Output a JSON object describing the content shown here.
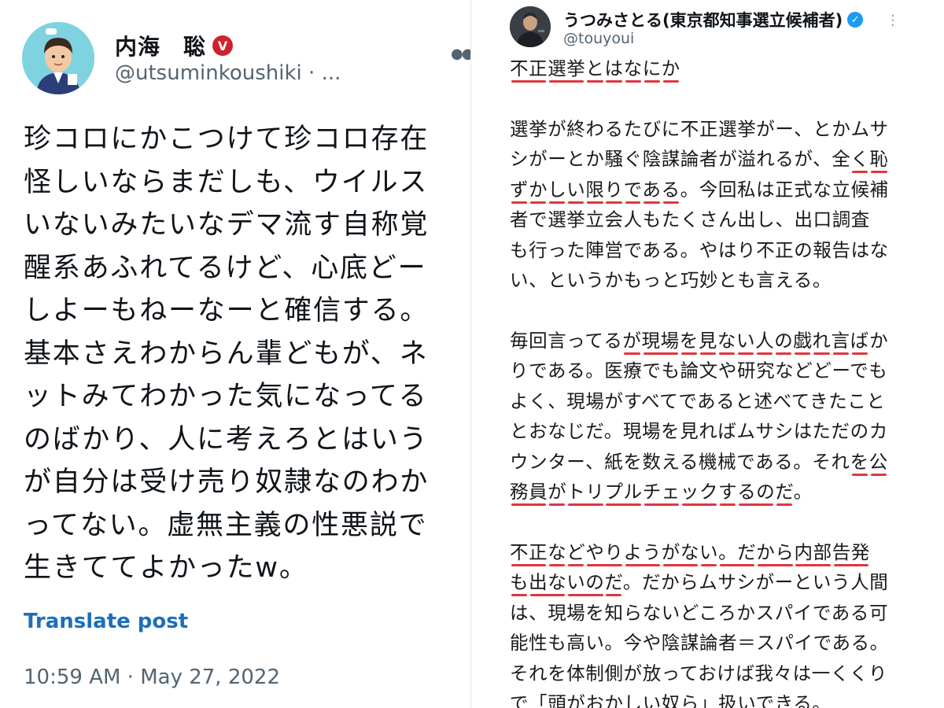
{
  "left_post": {
    "display_name": "内海　聡",
    "verified_badge": "V",
    "handle": "@utsuminkoushiki · ...",
    "body_lines": [
      "珍コロにかこつけて珍コロ存在",
      "怪しいならまだしも、ウイルス",
      "いないみたいなデマ流す自称覚",
      "醒系あふれてるけど、心底どー",
      "しよーもねーなーと確信する。",
      "基本さえわからん輩どもが、ネ",
      "ットみてわかった気になってる",
      "のばかり、人に考えろとはいう",
      "が自分は受け売り奴隷なのわか",
      "ってない。虚無主義の性悪説で",
      "生きててよかったw。"
    ],
    "translate_label": "Translate post",
    "timestamp": "10:59 AM · May 27, 2022",
    "more_icon": "ellipsis-icon",
    "badge_color": "#d0212c",
    "link_color": "#1d6fb8"
  },
  "right_post": {
    "display_name": "うつみさとる(東京都知事選立候補者)",
    "handle": "@touyoui",
    "verified_icon": "blue-check-icon",
    "more_icon": "vertical-ellipsis-icon",
    "title": "不正選挙とはなにか",
    "paragraphs": [
      [
        "選挙が終わるたびに不正選挙がー、とかムサ",
        "シがーとか騒ぐ陰謀論者が溢れるが、全く恥",
        "ずかしい限りである。今回私は正式な立候補",
        "者で選挙立会人もたくさん出し、出口調査",
        "も行った陣営である。やはり不正の報告はな",
        "い、というかもっと巧妙とも言える。"
      ],
      [
        "毎回言ってるが現場を見ない人の戯れ言ばか",
        "りである。医療でも論文や研究などどーでも",
        "よく、現場がすべてであると述べてきたこと",
        "とおなじだ。現場を見ればムサシはただのカ",
        "ウンター、紙を数える機械である。それを公",
        "務員がトリプルチェックするのだ。"
      ],
      [
        "不正などやりようがない。だから内部告発",
        "も出ないのだ。だからムサシがーという人間",
        "は、現場を知らないどころかスパイである可",
        "能性も高い。今や陰謀論者＝スパイである。",
        "それを体制側が放っておけば我々は一くくり",
        "で「頭がおかしい奴ら」扱いできる。"
      ]
    ],
    "badge_color": "#1d9bf0",
    "underline_color": "#e0373d"
  }
}
